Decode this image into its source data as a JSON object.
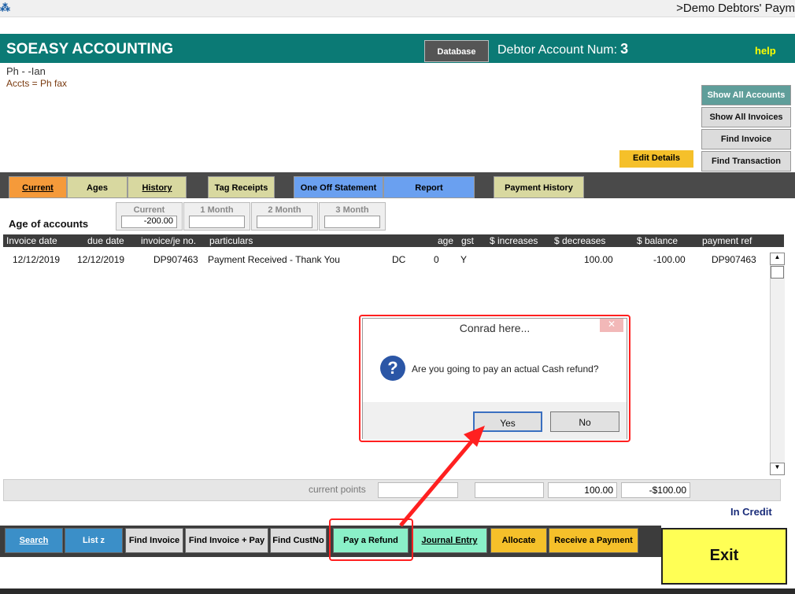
{
  "window": {
    "title": ">Demo Debtors' Paym",
    "app_icon": "app-icon"
  },
  "header": {
    "brand": "SOEASY ACCOUNTING",
    "database_button": "Database",
    "account_label": "Debtor Account Num:",
    "account_number": "3",
    "help": "help"
  },
  "info": {
    "line1": "Ph  -  -Ian",
    "line2": "Accts =  Ph  fax"
  },
  "side_buttons": [
    "Show All Accounts",
    "Show All Invoices",
    "Find Invoice",
    "Find Transaction"
  ],
  "edit_details": "Edit Details",
  "tabs": [
    "Current",
    "Ages",
    "History",
    "Tag Receipts",
    "One Off Statement",
    "Report",
    "Payment History"
  ],
  "ages": {
    "label": "Age of accounts",
    "current_label": "Current",
    "current_value": "-200.00",
    "month1_label": "1 Month",
    "month2_label": "2 Month",
    "month3_label": "3 Month"
  },
  "table": {
    "columns": [
      "Invoice date",
      "due date",
      "invoice/je no.",
      "particulars",
      "age",
      "gst",
      "$ increases",
      "$ decreases",
      "$ balance",
      "payment ref"
    ],
    "rows": [
      {
        "invoice_date": "12/12/2019",
        "due_date": "12/12/2019",
        "invoice_no": "DP907463",
        "particulars": "Payment Received - Thank You",
        "type": "DC",
        "age": "0",
        "gst": "Y",
        "increases": "",
        "decreases": "100.00",
        "balance": "-100.00",
        "payment_ref": "DP907463"
      }
    ]
  },
  "totals": {
    "current_points_label": "current points",
    "decreases_total": "100.00",
    "balance_total": "-$100.00"
  },
  "status": "In Credit",
  "bottom_buttons": [
    "Search",
    "List z",
    "Find Invoice",
    "Find Invoice + Pay",
    "Find CustNo",
    "Pay a Refund",
    "Journal Entry",
    "Allocate",
    "Receive a Payment"
  ],
  "exit": "Exit",
  "dialog": {
    "title": "Conrad here...",
    "close": "✕",
    "icon": "question-icon",
    "message": "Are you going to pay an actual Cash refund?",
    "yes": "Yes",
    "no": "No"
  },
  "colors": {
    "header": "#0b7a75",
    "annotation": "#ff2020",
    "exit": "#ffff55"
  }
}
